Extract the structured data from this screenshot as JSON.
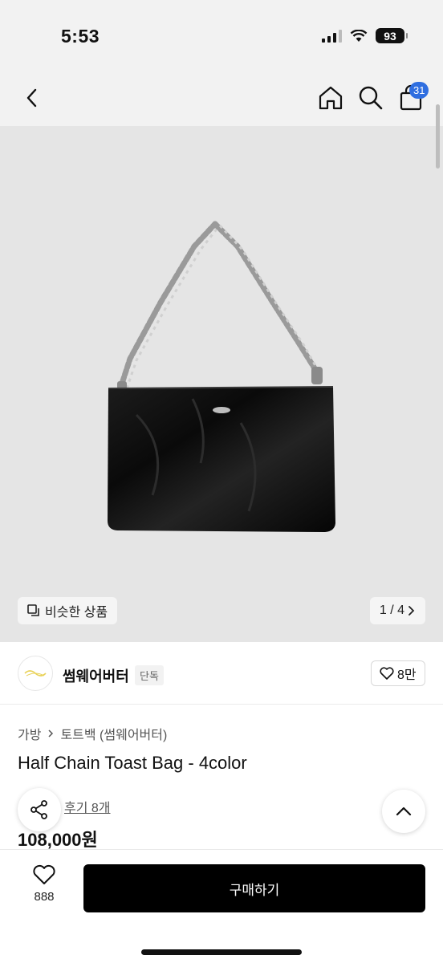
{
  "status_bar": {
    "time": "5:53",
    "battery": "93"
  },
  "nav": {
    "cart_count": "31"
  },
  "hero": {
    "similar_label": "비슷한 상품",
    "pager": "1 / 4"
  },
  "brand": {
    "name": "썸웨어버터",
    "tag": "단독",
    "likes": "8만"
  },
  "product": {
    "breadcrumb": [
      "가방",
      "토트백 (썸웨어버터)"
    ],
    "title": "Half Chain Toast Bag - 4color",
    "review_link": "후기 8개",
    "price": "108,000원"
  },
  "bottom_bar": {
    "wish_count": "888",
    "buy_label": "구매하기"
  },
  "colors": {
    "accent_badge": "#2f6ee0",
    "buy_button": "#000000",
    "hero_bg": "#e5e5e5"
  }
}
